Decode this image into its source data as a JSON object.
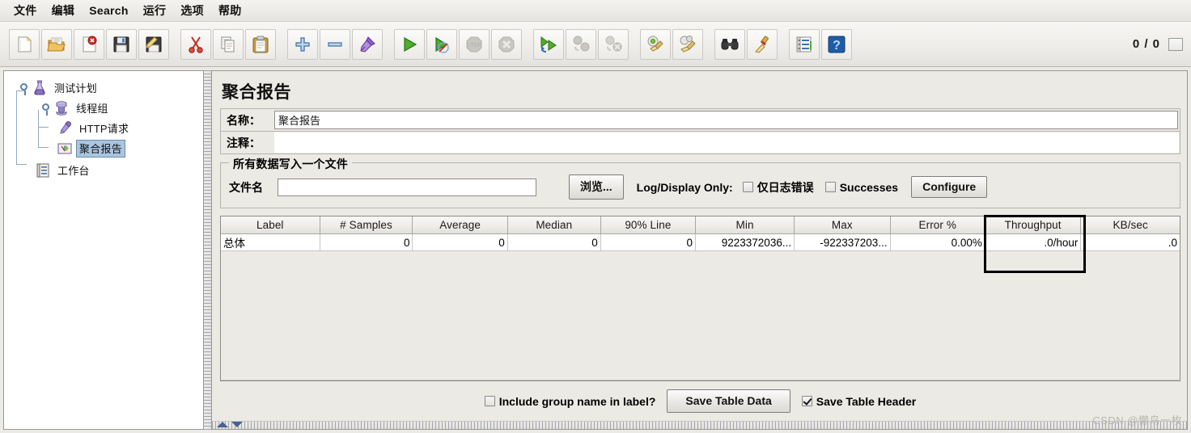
{
  "menu": {
    "items": [
      {
        "label": "文件",
        "name": "menu-file"
      },
      {
        "label": "编辑",
        "name": "menu-edit"
      },
      {
        "label": "Search",
        "name": "menu-search"
      },
      {
        "label": "运行",
        "name": "menu-run"
      },
      {
        "label": "选项",
        "name": "menu-options"
      },
      {
        "label": "帮助",
        "name": "menu-help"
      }
    ]
  },
  "toolbar": {
    "counter": "0 / 0",
    "buttons": [
      {
        "icon": "new-file-icon",
        "enabled": true
      },
      {
        "icon": "open-folder-icon",
        "enabled": true
      },
      {
        "icon": "close-file-icon",
        "enabled": true
      },
      {
        "icon": "save-icon",
        "enabled": true
      },
      {
        "icon": "save-as-icon",
        "enabled": true
      },
      {
        "icon": "cut-icon",
        "enabled": true
      },
      {
        "icon": "copy-icon",
        "enabled": true
      },
      {
        "icon": "paste-icon",
        "enabled": true
      },
      {
        "icon": "expand-all-icon",
        "enabled": true
      },
      {
        "icon": "collapse-all-icon",
        "enabled": true
      },
      {
        "icon": "toggle-icon",
        "enabled": true
      },
      {
        "icon": "start-icon",
        "enabled": true
      },
      {
        "icon": "start-no-pauses-icon",
        "enabled": true
      },
      {
        "icon": "stop-icon",
        "enabled": false
      },
      {
        "icon": "shutdown-icon",
        "enabled": false
      },
      {
        "icon": "remote-start-all-icon",
        "enabled": true
      },
      {
        "icon": "remote-stop-all-icon",
        "enabled": false
      },
      {
        "icon": "remote-shutdown-all-icon",
        "enabled": false
      },
      {
        "icon": "clear-icon",
        "enabled": true
      },
      {
        "icon": "clear-all-icon",
        "enabled": true
      },
      {
        "icon": "search-icon",
        "enabled": true
      },
      {
        "icon": "search-reset-icon",
        "enabled": true
      },
      {
        "icon": "function-helper-icon",
        "enabled": true
      },
      {
        "icon": "help-icon",
        "enabled": true
      }
    ]
  },
  "tree": {
    "nodes": [
      {
        "label": "测试计划",
        "icon": "test-plan-flask-icon",
        "depth": 0,
        "selected": false
      },
      {
        "label": "线程组",
        "icon": "thread-group-spool-icon",
        "depth": 1,
        "selected": false
      },
      {
        "label": "HTTP请求",
        "icon": "http-request-icon",
        "depth": 2,
        "selected": false
      },
      {
        "label": "聚合报告",
        "icon": "aggregate-report-icon",
        "depth": 2,
        "selected": true
      },
      {
        "label": "工作台",
        "icon": "workbench-icon",
        "depth": 0,
        "selected": false
      }
    ]
  },
  "panel": {
    "title": "聚合报告",
    "name_label": "名称：",
    "name_value": "聚合报告",
    "comment_label": "注释：",
    "comment_value": "",
    "filegroup": {
      "title": "所有数据写入一个文件",
      "filename_label": "文件名",
      "filename_value": "",
      "browse_button": "浏览...",
      "log_display_only_label": "Log/Display Only:",
      "errors_only_label": "仅日志错误",
      "errors_only_checked": false,
      "successes_label": "Successes",
      "successes_checked": false,
      "configure_button": "Configure"
    },
    "table": {
      "columns": [
        "Label",
        "# Samples",
        "Average",
        "Median",
        "90% Line",
        "Min",
        "Max",
        "Error %",
        "Throughput",
        "KB/sec"
      ],
      "rows": [
        [
          "总体",
          "0",
          "0",
          "0",
          "0",
          "9223372036...",
          "-922337203...",
          "0.00%",
          ".0/hour",
          ".0"
        ]
      ],
      "highlighted_column": "Throughput",
      "highlight_color": "#000000"
    },
    "bottom": {
      "include_group_name_label": "Include group name in label?",
      "include_group_name_checked": false,
      "save_table_data_button": "Save Table Data",
      "save_table_header_label": "Save Table Header",
      "save_table_header_checked": true
    }
  },
  "watermark": "CSDN @懒鸟一枚"
}
